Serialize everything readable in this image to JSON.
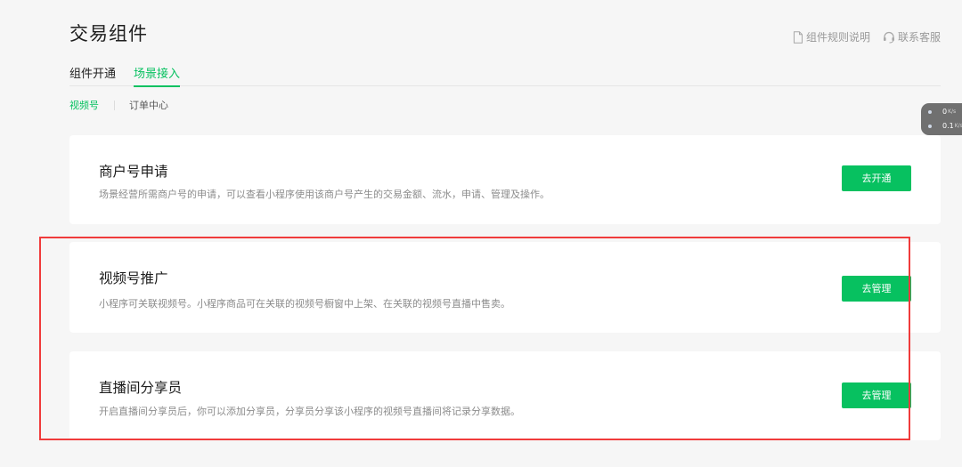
{
  "page": {
    "title": "交易组件"
  },
  "header": {
    "rules_link": "组件规则说明",
    "service_link": "联系客服"
  },
  "tabs": [
    {
      "label": "组件开通",
      "active": false
    },
    {
      "label": "场景接入",
      "active": true
    }
  ],
  "subtabs": [
    {
      "label": "视频号",
      "active": true
    },
    {
      "label": "订单中心",
      "active": false
    }
  ],
  "cards": [
    {
      "title": "商户号申请",
      "desc": "场景经营所需商户号的申请，可以查看小程序使用该商户号产生的交易金额、流水，申请、管理及操作。",
      "button": "去开通"
    },
    {
      "title": "视频号推广",
      "desc": "小程序可关联视频号。小程序商品可在关联的视频号橱窗中上架、在关联的视频号直播中售卖。",
      "button": "去管理"
    },
    {
      "title": "直播间分享员",
      "desc": "开启直播间分享员后，你可以添加分享员，分享员分享该小程序的视频号直播间将记录分享数据。",
      "button": "去管理"
    }
  ],
  "speed_widget": {
    "upload": "0",
    "download": "0.1",
    "unit": "K/s"
  },
  "colors": {
    "accent": "#07c160",
    "highlight": "#f03b3b",
    "background": "#f6f6f6"
  },
  "icons": {
    "rules": "document-icon",
    "service": "headset-icon"
  }
}
